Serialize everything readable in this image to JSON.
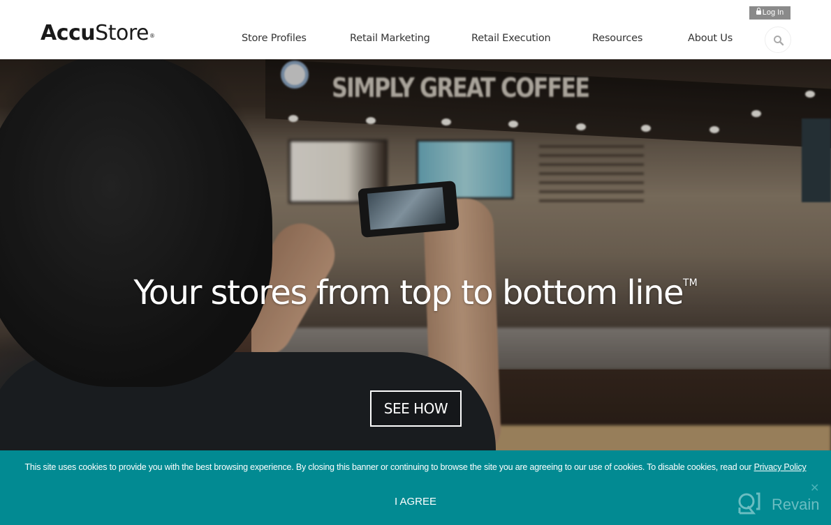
{
  "header": {
    "logo": {
      "bold_part": "Accu",
      "light_part": "Store",
      "mark": "®"
    },
    "nav": [
      {
        "label": "Store Profiles"
      },
      {
        "label": "Retail Marketing"
      },
      {
        "label": "Retail Execution"
      },
      {
        "label": "Resources"
      },
      {
        "label": "About Us"
      }
    ],
    "login": {
      "label": "Log In",
      "icon": "lock-icon"
    },
    "search": {
      "icon": "search-icon"
    }
  },
  "hero": {
    "title": "Your stores from top to bottom line",
    "trademark": "TM",
    "cta_label": "SEE HOW",
    "background_sign": "SIMPLY GREAT COFFEE"
  },
  "cookie_banner": {
    "text": "This site uses cookies to provide you with the best browsing experience. By closing this banner or continuing to browse the site you are agreeing to our use of cookies. To disable cookies, read our",
    "link_label": "Privacy Policy",
    "agree_label": "I AGREE",
    "close_icon": "close-icon",
    "background_color": "#028a92"
  },
  "watermark": {
    "label": "Revain",
    "icon": "revain-logo-icon"
  }
}
